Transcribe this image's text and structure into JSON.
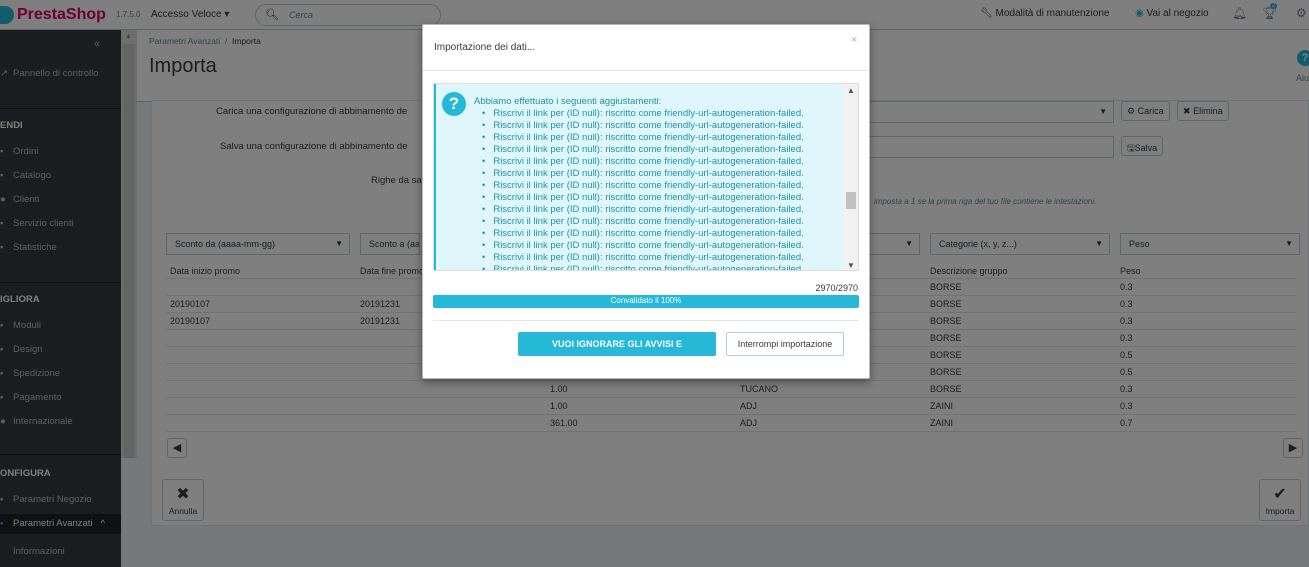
{
  "header": {
    "logo_text": "PrestaShop",
    "version": "1.7.5.0",
    "quick_access": "Accesso Veloce ▾",
    "search_placeholder": "Cerca",
    "maintenance": "Modalità di manutenzione",
    "view_shop": "Vai al negozio",
    "notifications_badge": "2"
  },
  "sidebar": {
    "dashboard": "Pannello di controllo",
    "section_sell": "ENDI",
    "sell_items": [
      "Ordini",
      "Catalogo",
      "Clienti",
      "Servizio clienti",
      "Statistiche"
    ],
    "section_improve": "IGLIORA",
    "improve_items": [
      "Moduli",
      "Design",
      "Spedizione",
      "Pagamento",
      "Internazionale"
    ],
    "section_configure": "ONFIGURA",
    "configure_items": [
      "Parametri Negozio",
      "Parametri Avanzati"
    ],
    "sub_items": [
      "Informazioni"
    ]
  },
  "page": {
    "breadcrumb_parent": "Parametri Avanzati",
    "breadcrumb_current": "Importa",
    "title": "Importa",
    "help_label": "Aiu"
  },
  "form": {
    "load_config_label": "Carica una configurazione di abbinamento de",
    "save_config_label": "Salva una configurazione di abbinamento de",
    "rows_label": "Righe da sa",
    "load_button": "Carica",
    "delete_button": "Elimina",
    "save_button": "Salva",
    "hint": "imposta a 1 se la prima riga del tuo file contiene le intestazioni."
  },
  "mapping_selects": [
    "Sconto da (aaaa-mm-gg)",
    "Sconto a (aaa",
    "Categorie (x, y, z...)",
    "Peso"
  ],
  "table": {
    "headers": [
      "Data inizio promo",
      "Data fine promo",
      "Descrizione gruppo",
      "Peso"
    ],
    "rows": [
      {
        "c1": "",
        "c2": "",
        "c3": "",
        "c4": "",
        "c5": "BORSE",
        "c6": "0.3"
      },
      {
        "c1": "20190107",
        "c2": "20191231",
        "c3": "",
        "c4": "",
        "c5": "BORSE",
        "c6": "0.3"
      },
      {
        "c1": "20190107",
        "c2": "20191231",
        "c3": "",
        "c4": "",
        "c5": "BORSE",
        "c6": "0.3"
      },
      {
        "c1": "",
        "c2": "",
        "c3": "",
        "c4": "",
        "c5": "BORSE",
        "c6": "0.3"
      },
      {
        "c1": "",
        "c2": "",
        "c3": "",
        "c4": "",
        "c5": "BORSE",
        "c6": "0.5"
      },
      {
        "c1": "",
        "c2": "",
        "c3": "",
        "c4": "",
        "c5": "BORSE",
        "c6": "0.5"
      },
      {
        "c1": "",
        "c2": "",
        "c3": "1.00",
        "c4": "TUCANO",
        "c5": "BORSE",
        "c6": "0.3"
      },
      {
        "c1": "",
        "c2": "",
        "c3": "1.00",
        "c4": "ADJ",
        "c5": "ZAINI",
        "c6": "0.3"
      },
      {
        "c1": "",
        "c2": "",
        "c3": "361.00",
        "c4": "ADJ",
        "c5": "ZAINI",
        "c6": "0.7"
      }
    ]
  },
  "footer": {
    "cancel": "Annulla",
    "import": "Importa"
  },
  "modal": {
    "title": "Importazione dei dati...",
    "close": "×",
    "alert_heading": "Abbiamo effettuato i seguenti aggiustamenti:",
    "alert_items": [
      "Riscrivi il link per (ID null): riscritto come friendly-url-autogeneration-failed.",
      "Riscrivi il link per (ID null): riscritto come friendly-url-autogeneration-failed.",
      "Riscrivi il link per (ID null): riscritto come friendly-url-autogeneration-failed.",
      "Riscrivi il link per (ID null): riscritto come friendly-url-autogeneration-failed.",
      "Riscrivi il link per (ID null): riscritto come friendly-url-autogeneration-failed.",
      "Riscrivi il link per (ID null): riscritto come friendly-url-autogeneration-failed.",
      "Riscrivi il link per (ID null): riscritto come friendly-url-autogeneration-failed.",
      "Riscrivi il link per (ID null): riscritto come friendly-url-autogeneration-failed.",
      "Riscrivi il link per (ID null): riscritto come friendly-url-autogeneration-failed.",
      "Riscrivi il link per (ID null): riscritto come friendly-url-autogeneration-failed.",
      "Riscrivi il link per (ID null): riscritto come friendly-url-autogeneration-failed.",
      "Riscrivi il link per (ID null): riscritto come friendly-url-autogeneration-failed.",
      "Riscrivi il link per (ID null): riscritto come friendly-url-autogeneration-failed.",
      "Riscrivi il link per (ID null): riscritto come friendly-url-autogeneration-failed."
    ],
    "count": "2970/2970",
    "progress_label": "Convalidato il 100%",
    "progress_value": 1.0,
    "continue_button": "VUOI IGNORARE GLI AVVISI E CONTINUARE?",
    "stop_button": "Interrompi importazione"
  },
  "colors": {
    "accent": "#25b9d7",
    "brand": "#df0067",
    "sidebar_bg": "#363a41",
    "alert_bg": "#dff6fb"
  }
}
